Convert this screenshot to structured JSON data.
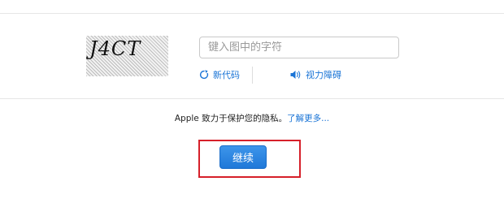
{
  "captcha": {
    "image_text": "J4CT",
    "input_placeholder": "键入图中的字符",
    "input_value": ""
  },
  "actions": {
    "new_code_label": "新代码",
    "new_code_icon": "refresh-icon",
    "accessibility_label": "视力障碍",
    "accessibility_icon": "speaker-icon"
  },
  "privacy": {
    "text": "Apple 致力于保护您的隐私。",
    "learn_more": "了解更多..."
  },
  "continue_button": {
    "label": "继续"
  },
  "colors": {
    "link": "#1a74d6",
    "button": "#1f78d8",
    "highlight": "#d6202a"
  }
}
